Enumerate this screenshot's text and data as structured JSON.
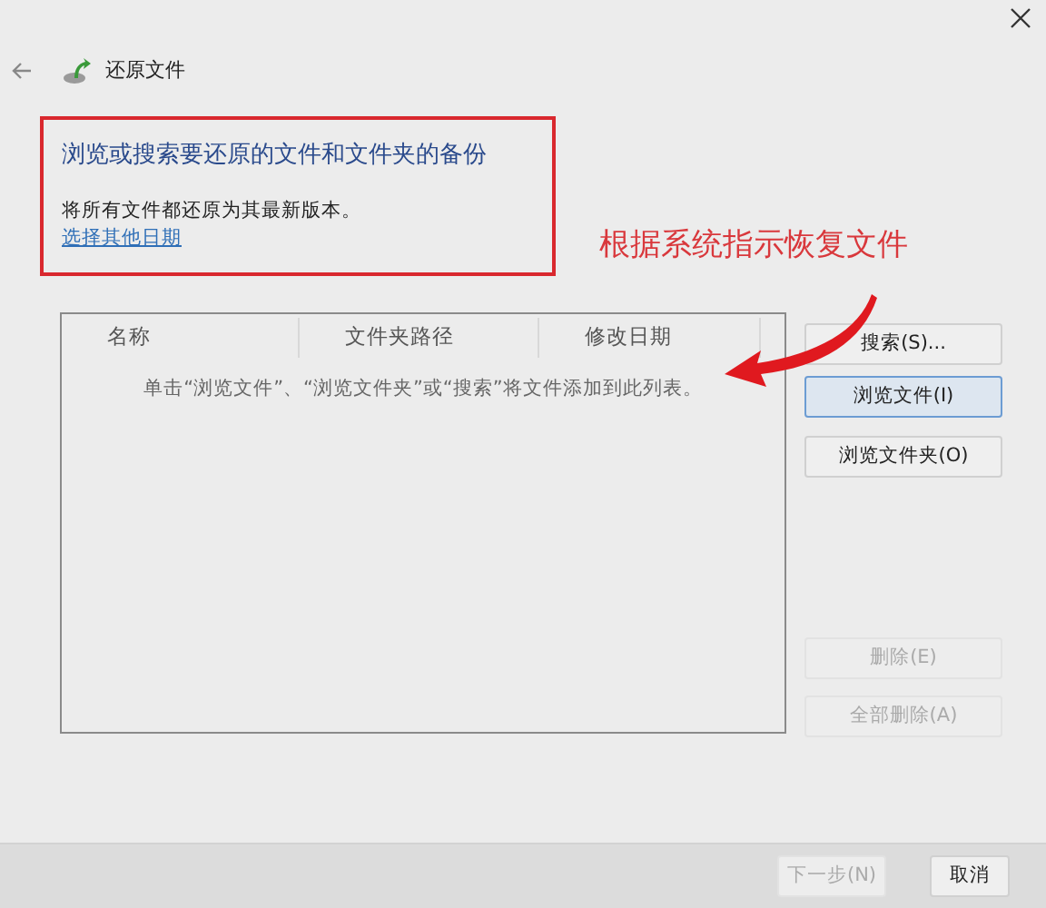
{
  "window": {
    "title": "还原文件"
  },
  "intro": {
    "heading": "浏览或搜索要还原的文件和文件夹的备份",
    "description": "将所有文件都还原为其最新版本。",
    "link": "选择其他日期",
    "highlighted": true
  },
  "annotation": {
    "text": "根据系统指示恢复文件"
  },
  "file_list": {
    "columns": [
      "名称",
      "文件夹路径",
      "修改日期"
    ],
    "empty_message": "单击“浏览文件”、“浏览文件夹”或“搜索”将文件添加到此列表。"
  },
  "side_buttons": [
    {
      "label": "搜索(S)...",
      "disabled": false,
      "focused": false
    },
    {
      "label": "浏览文件(I)",
      "disabled": false,
      "focused": true
    },
    {
      "label": "浏览文件夹(O)",
      "disabled": false,
      "focused": false
    },
    {
      "label": "删除(E)",
      "disabled": true,
      "focused": false
    },
    {
      "label": "全部删除(A)",
      "disabled": true,
      "focused": false
    }
  ],
  "footer_buttons": [
    {
      "label": "下一步(N)",
      "disabled": true
    },
    {
      "label": "取消",
      "disabled": false
    }
  ]
}
